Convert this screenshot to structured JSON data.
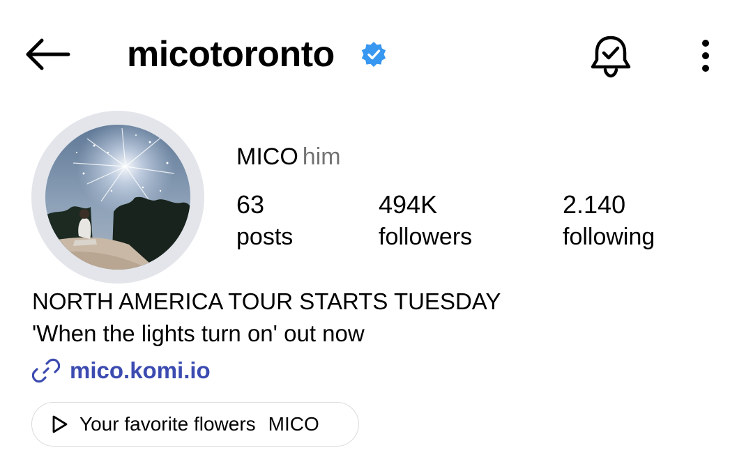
{
  "header": {
    "username": "micotoronto",
    "back_icon": "arrow-left-icon",
    "verified_icon": "verified-badge-icon",
    "notification_icon": "bell-check-icon",
    "more_icon": "vertical-ellipsis-icon",
    "verified_color": "#3897f0"
  },
  "profile": {
    "display_name": "MICO",
    "pronouns": "him",
    "stats": [
      {
        "value": "63",
        "label": "posts"
      },
      {
        "value": "494K",
        "label": "followers"
      },
      {
        "value": "2.140",
        "label": "following"
      }
    ],
    "bio_lines": [
      "NORTH AMERICA TOUR STARTS TUESDAY",
      "'When the lights turn on' out now"
    ],
    "link": {
      "icon": "link-icon",
      "text": "mico.komi.io",
      "color": "#3b4bb0"
    },
    "music": {
      "icon": "play-icon",
      "song": "Your favorite flowers",
      "artist": "MICO"
    }
  }
}
